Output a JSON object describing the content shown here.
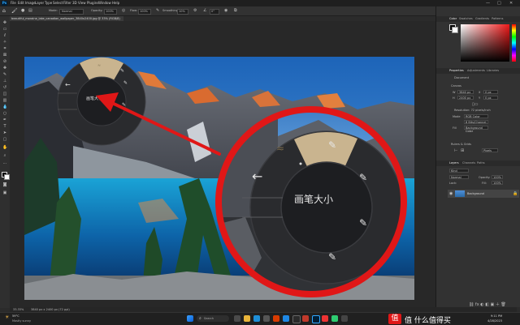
{
  "app": {
    "logo": "Ps",
    "menus": [
      "File",
      "Edit",
      "Image",
      "Layer",
      "Type",
      "Select",
      "Filter",
      "3D",
      "View",
      "Plugins",
      "Window",
      "Help"
    ],
    "window_controls": [
      "—",
      "□",
      "✕"
    ]
  },
  "options_bar": {
    "mode_label": "Mode:",
    "mode_value": "Normal",
    "opacity_label": "Opacity:",
    "opacity_value": "100%",
    "flow_label": "Flow:",
    "flow_value": "100%",
    "smoothing_label": "Smoothing:",
    "smoothing_value": "10%",
    "angle_value": "0°"
  },
  "document": {
    "tab_title": "beautiful_moraine_lake_canadian_wallpaper_3840x2400.jpg @ 33% (RGB/8)",
    "tab_close": "×"
  },
  "radial_menu": {
    "center_label": "画笔大小",
    "back_icon": "←"
  },
  "panels": {
    "color_tabs": [
      "Color",
      "Swatches",
      "Gradients",
      "Patterns"
    ],
    "properties_tabs": [
      "Properties",
      "Adjustments",
      "Libraries"
    ],
    "properties": {
      "document_label": "Document",
      "canvas_label": "Canvas",
      "w_label": "W",
      "w_value": "3840 px",
      "h_label": "H",
      "h_value": "2400 px",
      "x_label": "X",
      "x_value": "0 px",
      "y_label": "Y",
      "y_value": "0 px",
      "resolution_label": "Resolution: 72 pixels/inch",
      "mode_label": "Mode",
      "mode_value": "RGB Color",
      "depth_value": "8 Bits/Channel",
      "fill_label": "Fill",
      "fill_value": "Background Color",
      "rulers_label": "Rulers & Grids",
      "ruler_unit": "Pixels"
    },
    "layers_tabs": [
      "Layers",
      "Channels",
      "Paths"
    ],
    "layers": {
      "filter_label": "Kind",
      "blend_mode": "Normal",
      "opacity_label": "Opacity:",
      "opacity_value": "100%",
      "lock_label": "Lock:",
      "fill_label": "Fill:",
      "fill_value": "100%",
      "layer_name": "Background"
    }
  },
  "status_bar": {
    "zoom": "33.33%",
    "size": "3840 px x 2400 px (72 ppi)"
  },
  "taskbar": {
    "weather_temp": "59°C",
    "weather_text": "Mostly sunny",
    "search_placeholder": "Search",
    "time": "9:11 PM",
    "date": "4/28/2023",
    "watermark": "值 什么值得买"
  },
  "colors": {
    "accent_red": "#e01717",
    "ps_blue": "#31a8ff",
    "radial_selected": "#c9b48f"
  }
}
